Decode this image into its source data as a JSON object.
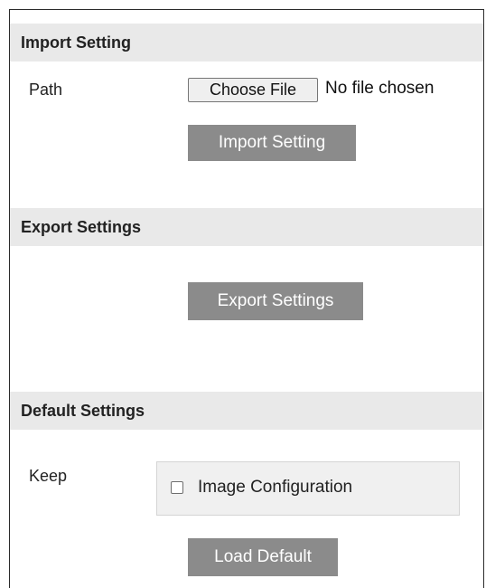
{
  "import": {
    "header": "Import Setting",
    "path_label": "Path",
    "choose_file_label": "Choose File",
    "file_status": "No file chosen",
    "button_label": "Import Setting"
  },
  "export": {
    "header": "Export Settings",
    "button_label": "Export Settings"
  },
  "default": {
    "header": "Default Settings",
    "keep_label": "Keep",
    "checkbox_label": "Image Configuration",
    "checkbox_checked": false,
    "button_label": "Load Default"
  },
  "colors": {
    "section_header_bg": "#e9e9e9",
    "button_bg": "#8b8b8b",
    "button_text": "#ffffff"
  }
}
